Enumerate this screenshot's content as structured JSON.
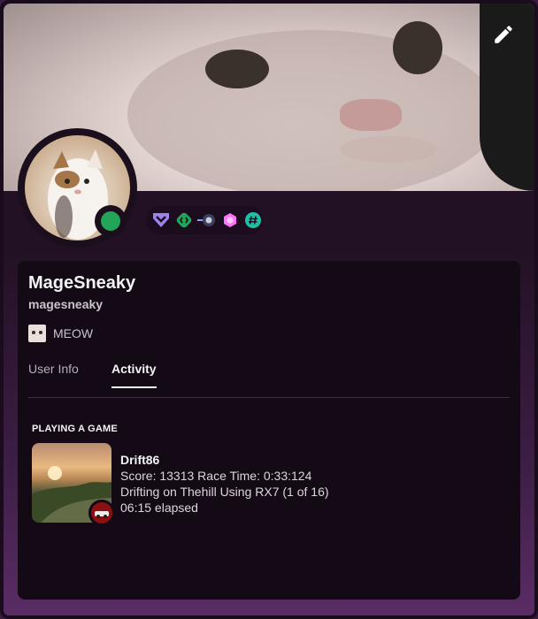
{
  "profile": {
    "display_name": "MageSneaky",
    "username": "magesneaky",
    "custom_status": "MEOW"
  },
  "tabs": [
    {
      "label": "User Info"
    },
    {
      "label": "Activity"
    }
  ],
  "activity": {
    "section_title": "PLAYING A GAME",
    "game": "Drift86",
    "details": "Score: 13313 Race Time: 0:33:124",
    "state": "Drifting on Thehill Using RX7 (1 of 16)",
    "elapsed": "06:15 elapsed"
  },
  "icons": {
    "edit": "pencil-icon",
    "badges": [
      "hypesquad-icon",
      "active-developer-icon",
      "quest-icon",
      "nitro-boost-icon",
      "originally-known-as-icon"
    ]
  },
  "colors": {
    "online_status": "#23a559",
    "card_background": "#140a16"
  }
}
